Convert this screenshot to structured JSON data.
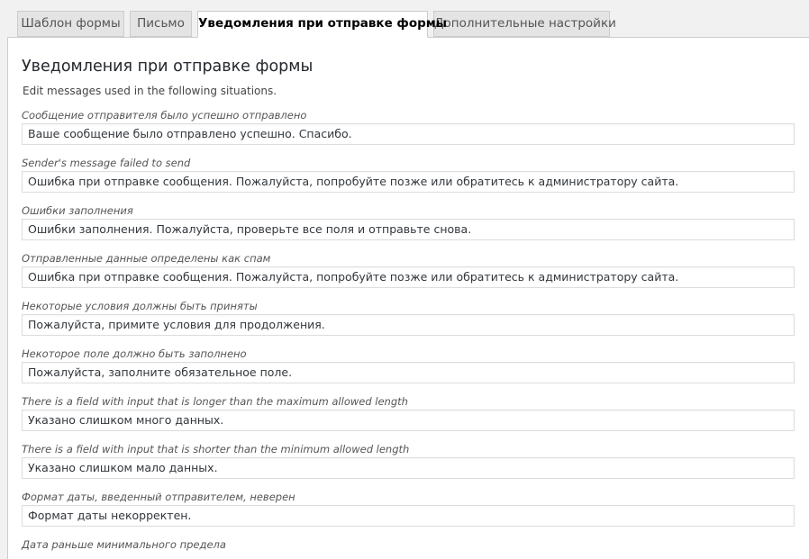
{
  "tabs": [
    {
      "label": "Шаблон формы",
      "active": false
    },
    {
      "label": "Письмо",
      "active": false
    },
    {
      "label": "Уведомления при отправке формы",
      "active": true
    },
    {
      "label": "Дополнительные настройки",
      "active": false
    }
  ],
  "panel": {
    "title": "Уведомления при отправке формы",
    "description": "Edit messages used in the following situations."
  },
  "messages": [
    {
      "label": "Сообщение отправителя было успешно отправлено",
      "value": "Ваше сообщение было отправлено успешно. Спасибо."
    },
    {
      "label": "Sender's message failed to send",
      "value": "Ошибка при отправке сообщения. Пожалуйста, попробуйте позже или обратитесь к администратору сайта."
    },
    {
      "label": "Ошибки заполнения",
      "value": "Ошибки заполнения. Пожалуйста, проверьте все поля и отправьте снова."
    },
    {
      "label": "Отправленные данные определены как спам",
      "value": "Ошибка при отправке сообщения. Пожалуйста, попробуйте позже или обратитесь к администратору сайта."
    },
    {
      "label": "Некоторые условия должны быть приняты",
      "value": "Пожалуйста, примите условия для продолжения."
    },
    {
      "label": "Некоторое поле должно быть заполнено",
      "value": "Пожалуйста, заполните обязательное поле."
    },
    {
      "label": "There is a field with input that is longer than the maximum allowed length",
      "value": "Указано слишком много данных."
    },
    {
      "label": "There is a field with input that is shorter than the minimum allowed length",
      "value": "Указано слишком мало данных."
    },
    {
      "label": "Формат даты, введенный отправителем, неверен",
      "value": "Формат даты некорректен."
    },
    {
      "label": "Дата раньше минимального предела",
      "value": ""
    }
  ]
}
